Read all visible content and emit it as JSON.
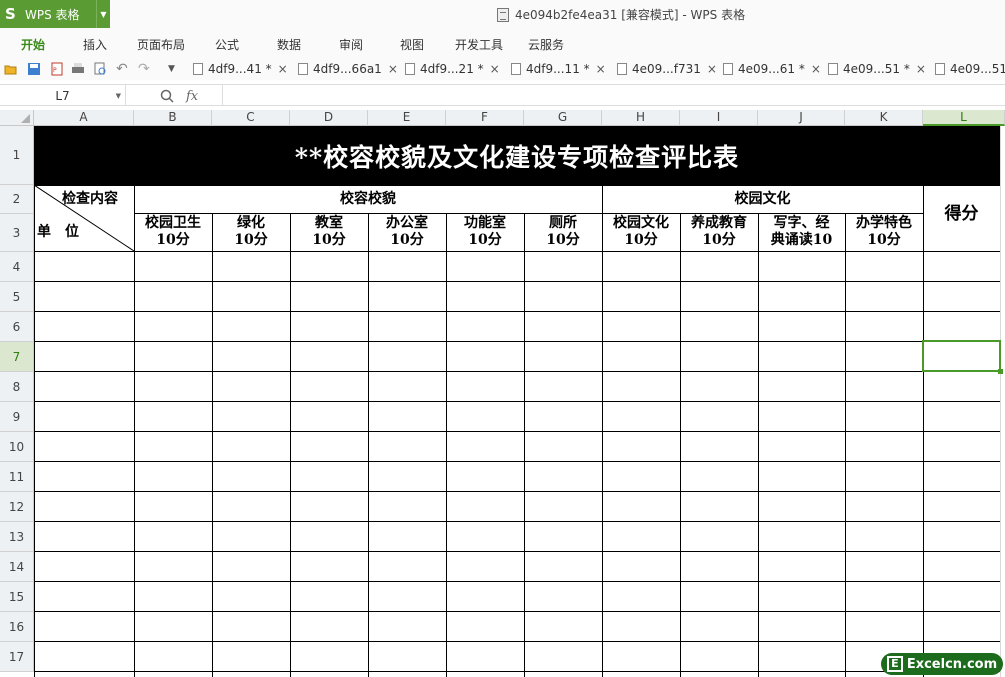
{
  "app": {
    "name": "WPS 表格",
    "logo": "S"
  },
  "window": {
    "title": "4e094b2fe4ea31 [兼容模式] - WPS 表格"
  },
  "menu": {
    "tabs": [
      "开始",
      "插入",
      "页面布局",
      "公式",
      "数据",
      "审阅",
      "视图",
      "开发工具",
      "云服务"
    ],
    "active": "开始"
  },
  "doc_tabs": [
    "4df9...41 *",
    "4df9...66a1",
    "4df9...21 *",
    "4df9...11 *",
    "4e09...f731",
    "4e09...61 *",
    "4e09...51 *",
    "4e09...51"
  ],
  "formula_bar": {
    "cell_ref": "L7",
    "formula": ""
  },
  "columns": [
    "A",
    "B",
    "C",
    "D",
    "E",
    "F",
    "G",
    "H",
    "I",
    "J",
    "K",
    "L"
  ],
  "rows": [
    "1",
    "2",
    "3",
    "4",
    "5",
    "6",
    "7",
    "8",
    "9",
    "10",
    "11",
    "12",
    "13",
    "14",
    "15",
    "16",
    "17"
  ],
  "selected_cell": {
    "column": "L",
    "row": "7"
  },
  "sheet": {
    "title": "**校容校貌及文化建设专项检查评比表",
    "diag_top": "检查内容",
    "diag_bottom": "单　位",
    "group1": "校容校貌",
    "group2": "校园文化",
    "score": "得分",
    "headers": [
      [
        "校园卫生",
        "10分"
      ],
      [
        "绿化",
        "10分"
      ],
      [
        "教室",
        "10分"
      ],
      [
        "办公室",
        "10分"
      ],
      [
        "功能室",
        "10分"
      ],
      [
        "厕所",
        "10分"
      ],
      [
        "校园文化",
        "10分"
      ],
      [
        "养成教育",
        "10分"
      ],
      [
        "写字、经",
        "典诵读10"
      ],
      [
        "办学特色",
        "10分"
      ]
    ]
  },
  "watermark": {
    "text": "Excelcn.com",
    "mark": "E"
  },
  "colors": {
    "accent": "#5a9b34",
    "selection": "#4a9a2a",
    "title_band": "#000000"
  }
}
